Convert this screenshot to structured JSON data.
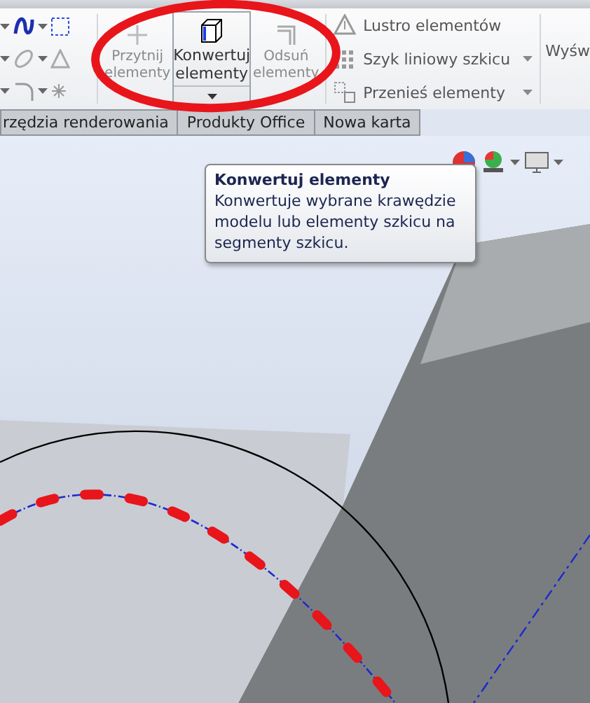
{
  "ribbon": {
    "big_buttons": [
      {
        "label": "Przytnij elementy",
        "disabled": true,
        "highlighted": false,
        "dropdown": false
      },
      {
        "label": "Konwertuj elementy",
        "disabled": false,
        "highlighted": true,
        "dropdown": true
      },
      {
        "label": "Odsuń elementy",
        "disabled": true,
        "highlighted": false,
        "dropdown": false
      }
    ],
    "commands": [
      {
        "label": "Lustro elementów",
        "dropdown": false
      },
      {
        "label": "Szyk liniowy szkicu",
        "dropdown": true
      },
      {
        "label": "Przenieś elementy",
        "dropdown": true
      }
    ],
    "cut_label": "Wyśw"
  },
  "tabs": [
    {
      "label": "rzędzia renderowania",
      "selected": false
    },
    {
      "label": "Produkty Office",
      "selected": false
    },
    {
      "label": "Nowa karta",
      "selected": false
    }
  ],
  "tooltip": {
    "title": "Konwertuj elementy",
    "text": "Konwertuje wybrane krawędzie modelu lub elementy szkicu na segmenty szkicu."
  }
}
